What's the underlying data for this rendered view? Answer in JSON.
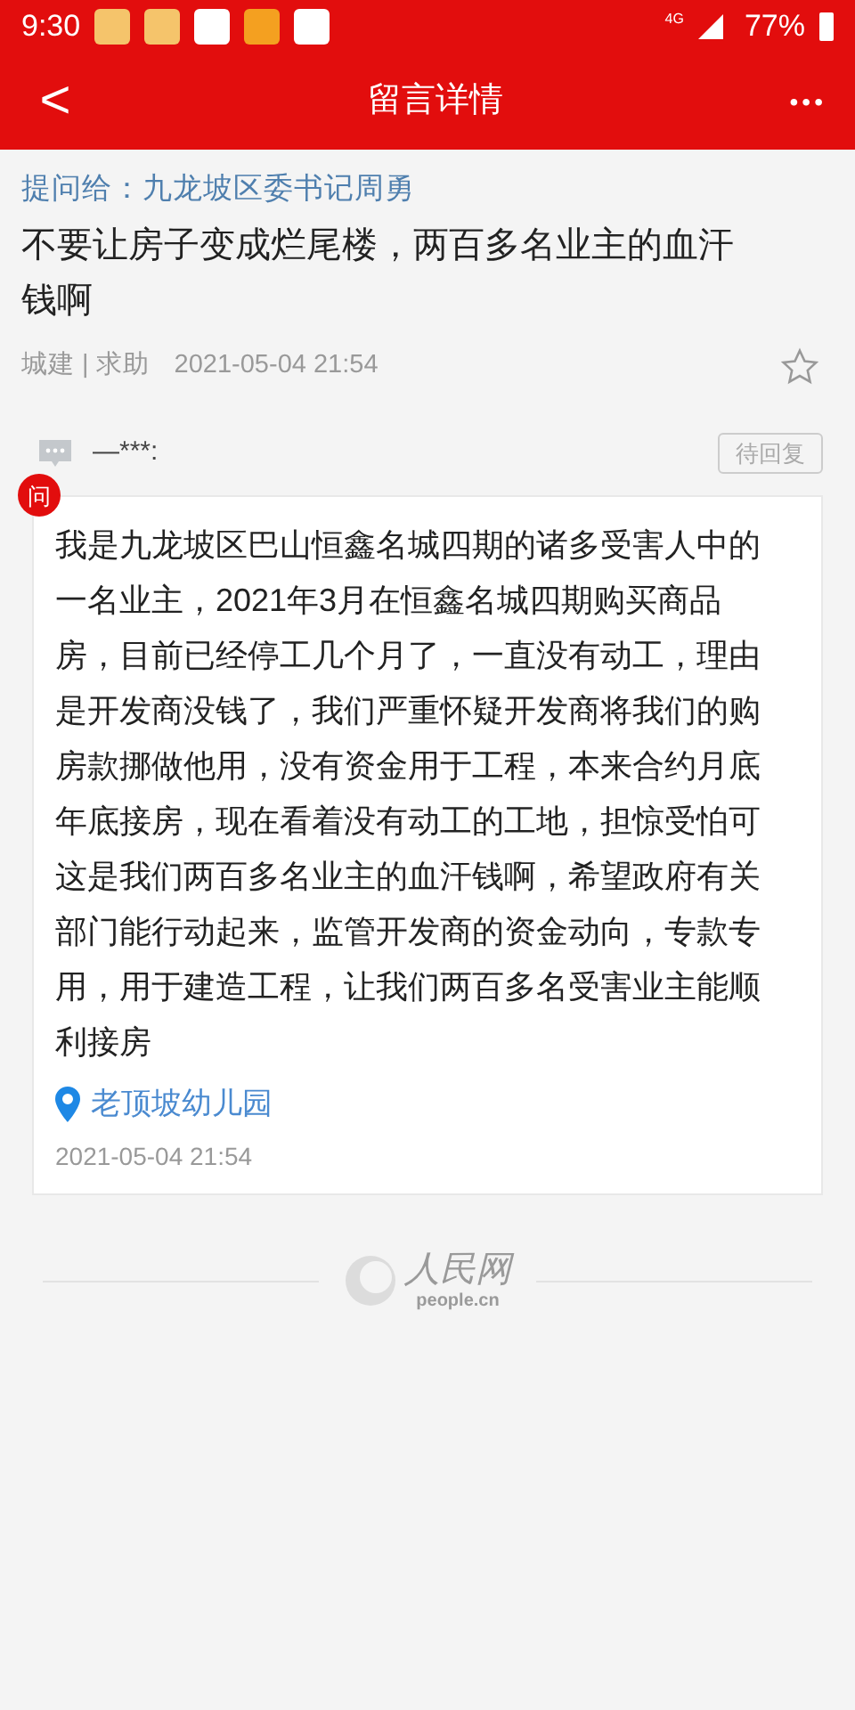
{
  "status_bar": {
    "time": "9:30",
    "network": "4G",
    "battery": "77%"
  },
  "header": {
    "back": "<",
    "title": "留言详情",
    "more": "•••"
  },
  "question": {
    "to": "提问给：九龙坡区委书记周勇",
    "title": "不要让房子变成烂尾楼，两百多名业主的血汗钱啊",
    "category": "城建",
    "separator": "|",
    "type": "求助",
    "date": "2021-05-04 21:54",
    "starred": false
  },
  "message": {
    "author": "—***:",
    "status": "待回复",
    "badge": "问",
    "body": "我是九龙坡区巴山恒鑫名城四期的诸多受害人中的一名业主，2021年3月在恒鑫名城四期购买商品房，目前已经停工几个月了，一直没有动工，理由是开发商没钱了，我们严重怀疑开发商将我们的购房款挪做他用，没有资金用于工程，本来合约月底年底接房，现在看着没有动工的工地，担惊受怕可这是我们两百多名业主的血汗钱啊，希望政府有关部门能行动起来，监管开发商的资金动向，专款专用，用于建造工程，让我们两百多名受害业主能顺利接房",
    "location": "老顶坡幼儿园",
    "date": "2021-05-04 21:54"
  },
  "footer": {
    "logo": "人民网",
    "domain": "people.cn"
  }
}
